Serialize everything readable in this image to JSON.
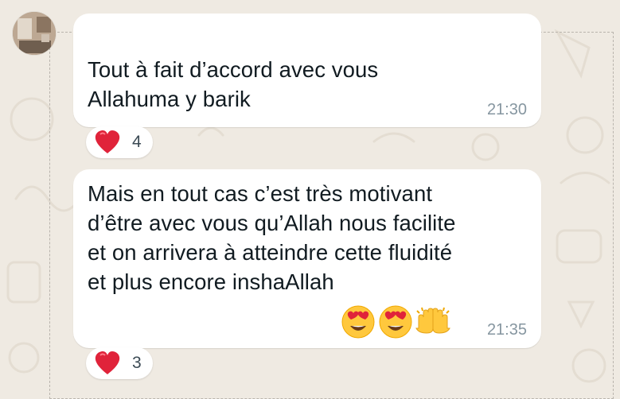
{
  "chat": {
    "messages": [
      {
        "text": "Tout à fait d’accord avec vous\nAllahuma y barik",
        "time": "21:30",
        "reaction": {
          "emoji": "heart-icon",
          "count": "4"
        }
      },
      {
        "text": "Mais en tout cas c’est très motivant\nd’être avec vous qu’Allah nous facilite\net on arrivera à atteindre cette fluidité\net plus encore inshaAllah",
        "emojis": [
          "heart-eyes-emoji",
          "heart-eyes-emoji",
          "raising-hands-emoji"
        ],
        "time": "21:35",
        "reaction": {
          "emoji": "heart-icon",
          "count": "3"
        }
      }
    ]
  },
  "colors": {
    "wallpaper": "#efeae2",
    "bubble": "#ffffff",
    "text": "#111b21",
    "time": "#8696a0",
    "heart": "#e0233a"
  }
}
